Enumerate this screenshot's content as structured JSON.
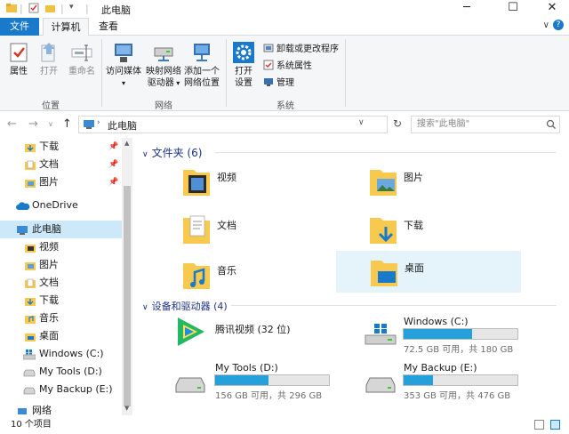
{
  "window": {
    "title": "此电脑",
    "minimize_glyph": "─",
    "maximize_glyph": "☐",
    "close_glyph": "✕"
  },
  "tabs": [
    {
      "label": "文件"
    },
    {
      "label": "计算机"
    },
    {
      "label": "查看"
    }
  ],
  "ribbon": {
    "location": {
      "group_label": "位置",
      "properties": "属性",
      "open": "打开",
      "rename": "重命名"
    },
    "network": {
      "group_label": "网络",
      "access_media": "访问媒体",
      "map_drive_1": "映射网络",
      "map_drive_2": "驱动器",
      "add_location_1": "添加一个",
      "add_location_2": "网络位置"
    },
    "system": {
      "group_label": "系统",
      "open_settings_1": "打开",
      "open_settings_2": "设置",
      "uninstall": "卸载或更改程序",
      "system_properties": "系统属性",
      "manage": "管理"
    }
  },
  "address": {
    "path": "此电脑",
    "search_placeholder": "搜索\"此电脑\""
  },
  "nav_pane": {
    "quick_access": [
      {
        "label": "下载"
      },
      {
        "label": "文档"
      },
      {
        "label": "图片"
      }
    ],
    "onedrive": "OneDrive",
    "this_pc": "此电脑",
    "this_pc_children": [
      {
        "label": "视频"
      },
      {
        "label": "图片"
      },
      {
        "label": "文档"
      },
      {
        "label": "下载"
      },
      {
        "label": "音乐"
      },
      {
        "label": "桌面"
      },
      {
        "label": "Windows (C:)"
      },
      {
        "label": "My Tools (D:)"
      },
      {
        "label": "My Backup (E:)"
      }
    ],
    "network": "网络"
  },
  "content": {
    "folders_header": "文件夹 (6)",
    "folders": [
      {
        "name": "视频"
      },
      {
        "name": "图片"
      },
      {
        "name": "文档"
      },
      {
        "name": "下载"
      },
      {
        "name": "音乐"
      },
      {
        "name": "桌面"
      }
    ],
    "drives_header": "设备和驱动器 (4)",
    "drives": [
      {
        "name": "腾讯视频 (32 位)",
        "info": "",
        "used_fraction": null
      },
      {
        "name": "Windows (C:)",
        "info": "72.5 GB 可用，共 180 GB",
        "used_fraction": 0.6
      },
      {
        "name": "My Tools (D:)",
        "info": "156 GB 可用，共 296 GB",
        "used_fraction": 0.47
      },
      {
        "name": "My Backup (E:)",
        "info": "353 GB 可用，共 476 GB",
        "used_fraction": 0.26
      }
    ]
  },
  "status": {
    "item_count": "10 个项目"
  },
  "colors": {
    "accent": "#1979ca",
    "drive_bar": "#26a0da",
    "folder": "#f7c94f",
    "selection": "#e5f3fb"
  }
}
